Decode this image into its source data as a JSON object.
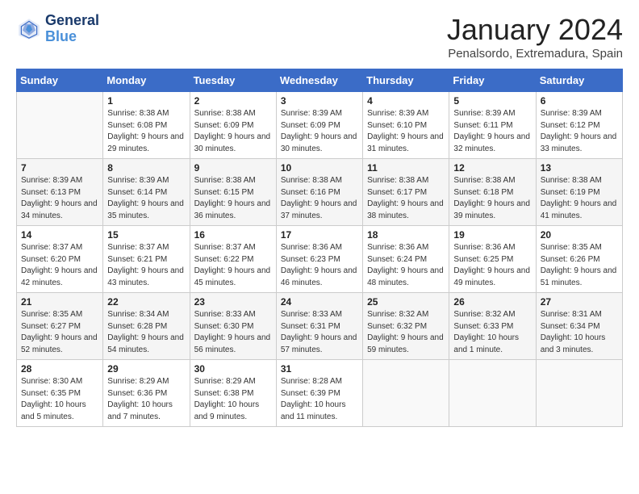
{
  "header": {
    "logo_line1": "General",
    "logo_line2": "Blue",
    "month_year": "January 2024",
    "location": "Penalsordo, Extremadura, Spain"
  },
  "days_of_week": [
    "Sunday",
    "Monday",
    "Tuesday",
    "Wednesday",
    "Thursday",
    "Friday",
    "Saturday"
  ],
  "weeks": [
    [
      {
        "day": "",
        "sunrise": "",
        "sunset": "",
        "daylight": ""
      },
      {
        "day": "1",
        "sunrise": "Sunrise: 8:38 AM",
        "sunset": "Sunset: 6:08 PM",
        "daylight": "Daylight: 9 hours and 29 minutes."
      },
      {
        "day": "2",
        "sunrise": "Sunrise: 8:38 AM",
        "sunset": "Sunset: 6:09 PM",
        "daylight": "Daylight: 9 hours and 30 minutes."
      },
      {
        "day": "3",
        "sunrise": "Sunrise: 8:39 AM",
        "sunset": "Sunset: 6:09 PM",
        "daylight": "Daylight: 9 hours and 30 minutes."
      },
      {
        "day": "4",
        "sunrise": "Sunrise: 8:39 AM",
        "sunset": "Sunset: 6:10 PM",
        "daylight": "Daylight: 9 hours and 31 minutes."
      },
      {
        "day": "5",
        "sunrise": "Sunrise: 8:39 AM",
        "sunset": "Sunset: 6:11 PM",
        "daylight": "Daylight: 9 hours and 32 minutes."
      },
      {
        "day": "6",
        "sunrise": "Sunrise: 8:39 AM",
        "sunset": "Sunset: 6:12 PM",
        "daylight": "Daylight: 9 hours and 33 minutes."
      }
    ],
    [
      {
        "day": "7",
        "sunrise": "Sunrise: 8:39 AM",
        "sunset": "Sunset: 6:13 PM",
        "daylight": "Daylight: 9 hours and 34 minutes."
      },
      {
        "day": "8",
        "sunrise": "Sunrise: 8:39 AM",
        "sunset": "Sunset: 6:14 PM",
        "daylight": "Daylight: 9 hours and 35 minutes."
      },
      {
        "day": "9",
        "sunrise": "Sunrise: 8:38 AM",
        "sunset": "Sunset: 6:15 PM",
        "daylight": "Daylight: 9 hours and 36 minutes."
      },
      {
        "day": "10",
        "sunrise": "Sunrise: 8:38 AM",
        "sunset": "Sunset: 6:16 PM",
        "daylight": "Daylight: 9 hours and 37 minutes."
      },
      {
        "day": "11",
        "sunrise": "Sunrise: 8:38 AM",
        "sunset": "Sunset: 6:17 PM",
        "daylight": "Daylight: 9 hours and 38 minutes."
      },
      {
        "day": "12",
        "sunrise": "Sunrise: 8:38 AM",
        "sunset": "Sunset: 6:18 PM",
        "daylight": "Daylight: 9 hours and 39 minutes."
      },
      {
        "day": "13",
        "sunrise": "Sunrise: 8:38 AM",
        "sunset": "Sunset: 6:19 PM",
        "daylight": "Daylight: 9 hours and 41 minutes."
      }
    ],
    [
      {
        "day": "14",
        "sunrise": "Sunrise: 8:37 AM",
        "sunset": "Sunset: 6:20 PM",
        "daylight": "Daylight: 9 hours and 42 minutes."
      },
      {
        "day": "15",
        "sunrise": "Sunrise: 8:37 AM",
        "sunset": "Sunset: 6:21 PM",
        "daylight": "Daylight: 9 hours and 43 minutes."
      },
      {
        "day": "16",
        "sunrise": "Sunrise: 8:37 AM",
        "sunset": "Sunset: 6:22 PM",
        "daylight": "Daylight: 9 hours and 45 minutes."
      },
      {
        "day": "17",
        "sunrise": "Sunrise: 8:36 AM",
        "sunset": "Sunset: 6:23 PM",
        "daylight": "Daylight: 9 hours and 46 minutes."
      },
      {
        "day": "18",
        "sunrise": "Sunrise: 8:36 AM",
        "sunset": "Sunset: 6:24 PM",
        "daylight": "Daylight: 9 hours and 48 minutes."
      },
      {
        "day": "19",
        "sunrise": "Sunrise: 8:36 AM",
        "sunset": "Sunset: 6:25 PM",
        "daylight": "Daylight: 9 hours and 49 minutes."
      },
      {
        "day": "20",
        "sunrise": "Sunrise: 8:35 AM",
        "sunset": "Sunset: 6:26 PM",
        "daylight": "Daylight: 9 hours and 51 minutes."
      }
    ],
    [
      {
        "day": "21",
        "sunrise": "Sunrise: 8:35 AM",
        "sunset": "Sunset: 6:27 PM",
        "daylight": "Daylight: 9 hours and 52 minutes."
      },
      {
        "day": "22",
        "sunrise": "Sunrise: 8:34 AM",
        "sunset": "Sunset: 6:28 PM",
        "daylight": "Daylight: 9 hours and 54 minutes."
      },
      {
        "day": "23",
        "sunrise": "Sunrise: 8:33 AM",
        "sunset": "Sunset: 6:30 PM",
        "daylight": "Daylight: 9 hours and 56 minutes."
      },
      {
        "day": "24",
        "sunrise": "Sunrise: 8:33 AM",
        "sunset": "Sunset: 6:31 PM",
        "daylight": "Daylight: 9 hours and 57 minutes."
      },
      {
        "day": "25",
        "sunrise": "Sunrise: 8:32 AM",
        "sunset": "Sunset: 6:32 PM",
        "daylight": "Daylight: 9 hours and 59 minutes."
      },
      {
        "day": "26",
        "sunrise": "Sunrise: 8:32 AM",
        "sunset": "Sunset: 6:33 PM",
        "daylight": "Daylight: 10 hours and 1 minute."
      },
      {
        "day": "27",
        "sunrise": "Sunrise: 8:31 AM",
        "sunset": "Sunset: 6:34 PM",
        "daylight": "Daylight: 10 hours and 3 minutes."
      }
    ],
    [
      {
        "day": "28",
        "sunrise": "Sunrise: 8:30 AM",
        "sunset": "Sunset: 6:35 PM",
        "daylight": "Daylight: 10 hours and 5 minutes."
      },
      {
        "day": "29",
        "sunrise": "Sunrise: 8:29 AM",
        "sunset": "Sunset: 6:36 PM",
        "daylight": "Daylight: 10 hours and 7 minutes."
      },
      {
        "day": "30",
        "sunrise": "Sunrise: 8:29 AM",
        "sunset": "Sunset: 6:38 PM",
        "daylight": "Daylight: 10 hours and 9 minutes."
      },
      {
        "day": "31",
        "sunrise": "Sunrise: 8:28 AM",
        "sunset": "Sunset: 6:39 PM",
        "daylight": "Daylight: 10 hours and 11 minutes."
      },
      {
        "day": "",
        "sunrise": "",
        "sunset": "",
        "daylight": ""
      },
      {
        "day": "",
        "sunrise": "",
        "sunset": "",
        "daylight": ""
      },
      {
        "day": "",
        "sunrise": "",
        "sunset": "",
        "daylight": ""
      }
    ]
  ]
}
